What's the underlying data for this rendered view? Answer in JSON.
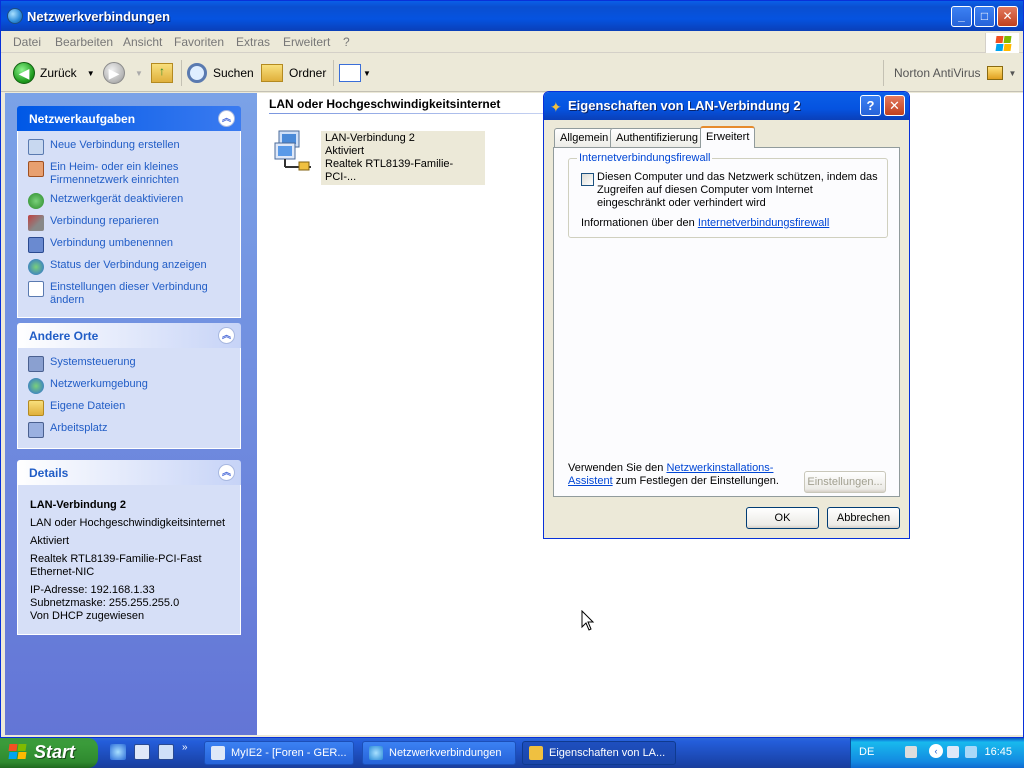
{
  "window": {
    "title": "Netzwerkverbindungen"
  },
  "menu": [
    "Datei",
    "Bearbeiten",
    "Ansicht",
    "Favoriten",
    "Extras",
    "Erweitert",
    "?"
  ],
  "toolbar": {
    "back": "Zurück",
    "search": "Suchen",
    "folders": "Ordner",
    "norton": "Norton AntiVirus"
  },
  "sidebar": {
    "network_tasks": {
      "title": "Netzwerkaufgaben",
      "items": [
        {
          "label": "Neue Verbindung erstellen",
          "icon": "new-connection-icon"
        },
        {
          "label": "Ein Heim- oder ein kleines Firmennetzwerk einrichten",
          "icon": "home-network-icon"
        },
        {
          "label": "Netzwerkgerät deaktivieren",
          "icon": "disable-device-icon"
        },
        {
          "label": "Verbindung reparieren",
          "icon": "repair-icon"
        },
        {
          "label": "Verbindung umbenennen",
          "icon": "rename-icon"
        },
        {
          "label": "Status der Verbindung anzeigen",
          "icon": "status-icon"
        },
        {
          "label": "Einstellungen dieser Verbindung ändern",
          "icon": "settings-icon"
        }
      ]
    },
    "other_places": {
      "title": "Andere Orte",
      "items": [
        {
          "label": "Systemsteuerung",
          "icon": "control-panel-icon"
        },
        {
          "label": "Netzwerkumgebung",
          "icon": "network-places-icon"
        },
        {
          "label": "Eigene Dateien",
          "icon": "my-documents-icon"
        },
        {
          "label": "Arbeitsplatz",
          "icon": "my-computer-icon"
        }
      ]
    },
    "details": {
      "title": "Details",
      "name": "LAN-Verbindung 2",
      "type": "LAN oder Hochgeschwindigkeitsinternet",
      "status": "Aktiviert",
      "adapter": "Realtek RTL8139-Familie-PCI-Fast Ethernet-NIC",
      "ip": "IP-Adresse: 192.168.1.33",
      "subnet": "Subnetzmaske: 255.255.255.0",
      "dhcp": "Von DHCP zugewiesen"
    }
  },
  "content": {
    "category": "LAN oder Hochgeschwindigkeitsinternet",
    "connection": {
      "name": "LAN-Verbindung 2",
      "status": "Aktiviert",
      "adapter": "Realtek RTL8139-Familie-PCI-..."
    }
  },
  "dialog": {
    "title": "Eigenschaften von LAN-Verbindung 2",
    "tabs": [
      "Allgemein",
      "Authentifizierung",
      "Erweitert"
    ],
    "group_title": "Internetverbindungsfirewall",
    "checkbox_label": "Diesen Computer und das Netzwerk schützen, indem das Zugreifen auf diesen Computer vom Internet eingeschränkt oder verhindert wird",
    "checkbox_checked": false,
    "info_prefix": "Informationen über den",
    "info_link": "Internetverbindungsfirewall",
    "wizard_prefix": "Verwenden Sie den",
    "wizard_link1": "Netzwerkinstallations-",
    "wizard_link2": "Assistent",
    "wizard_suffix": "zum Festlegen der Einstellungen.",
    "settings_button": "Einstellungen...",
    "ok": "OK",
    "cancel": "Abbrechen"
  },
  "taskbar": {
    "start": "Start",
    "tasks": [
      {
        "label": "MyIE2 - [Foren - GER...",
        "icon": "myie-icon"
      },
      {
        "label": "Netzwerkverbindungen",
        "icon": "network-connections-icon"
      },
      {
        "label": "Eigenschaften von LA...",
        "icon": "lan-properties-icon"
      }
    ],
    "language": "DE",
    "clock": "16:45"
  }
}
